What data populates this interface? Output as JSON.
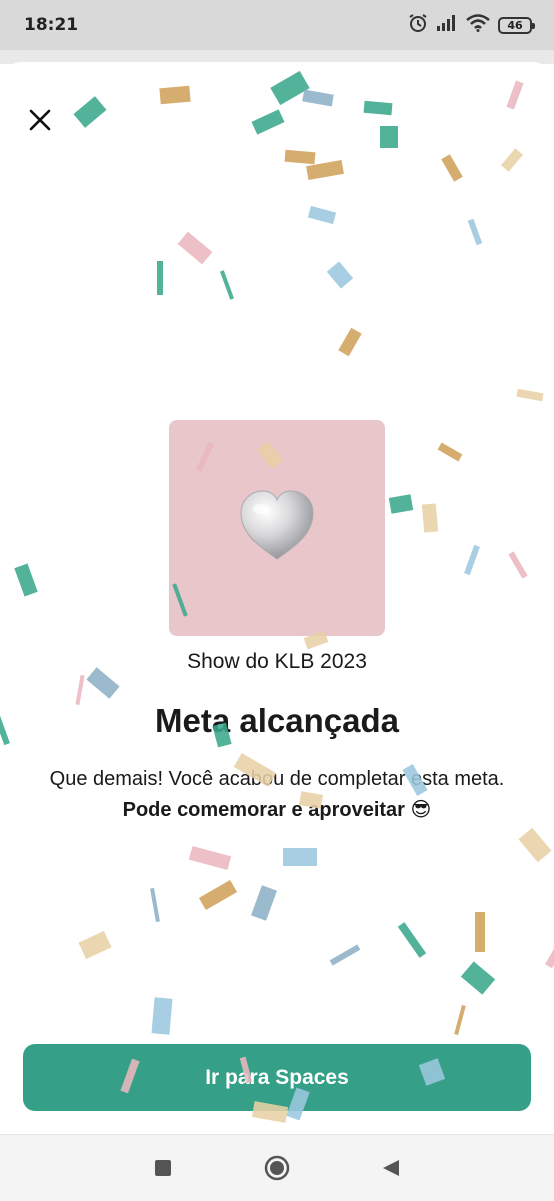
{
  "status_bar": {
    "time": "18:21",
    "battery": "46",
    "icons": [
      "alarm-icon",
      "signal-icon",
      "wifi-icon",
      "battery-icon"
    ]
  },
  "close_icon": "close-icon",
  "goal": {
    "image_icon": "silver-heart-balloon",
    "image_bg": "#e8c6ca",
    "name": "Show do KLB 2023"
  },
  "headline": "Meta alcançada",
  "message": {
    "text": "Que demais! Você acabou de completar esta meta. ",
    "bold": "Pode comemorar e aproveitar",
    "emoji": "😎"
  },
  "cta": {
    "label": "Ir para Spaces",
    "color": "#35a087"
  },
  "nav": {
    "recents_icon": "square-icon",
    "home_icon": "circle-icon",
    "back_icon": "triangle-back-icon"
  },
  "colors": {
    "confetti": [
      "#3aa88c",
      "#cfa25a",
      "#e9b7be",
      "#9cc7df",
      "#8eb1c7",
      "#e7d0a5"
    ]
  }
}
